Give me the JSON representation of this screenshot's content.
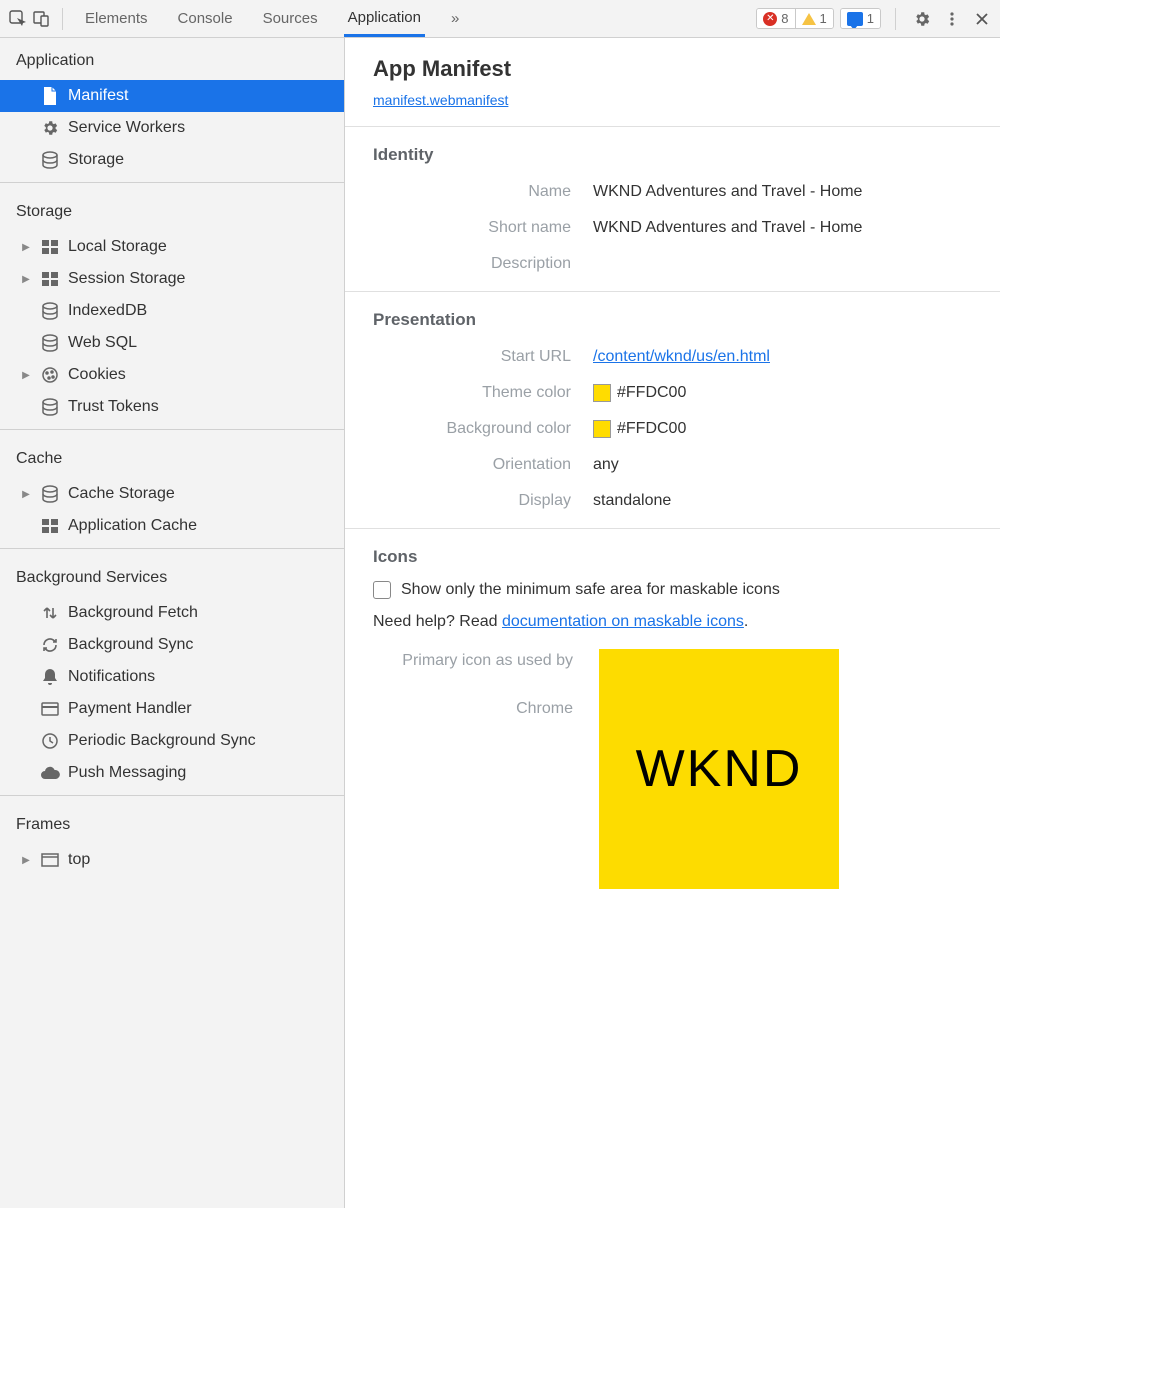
{
  "toolbar": {
    "tabs": [
      "Elements",
      "Console",
      "Sources",
      "Application"
    ],
    "active_tab": "Application",
    "more_glyph": "»",
    "errors_count": "8",
    "warnings_count": "1",
    "messages_count": "1"
  },
  "sidebar": {
    "groups": [
      {
        "title": "Application",
        "items": [
          {
            "label": "Manifest",
            "icon": "file-icon",
            "selected": true
          },
          {
            "label": "Service Workers",
            "icon": "gear-icon"
          },
          {
            "label": "Storage",
            "icon": "database-icon"
          }
        ]
      },
      {
        "title": "Storage",
        "items": [
          {
            "label": "Local Storage",
            "icon": "grid-icon",
            "expandable": true
          },
          {
            "label": "Session Storage",
            "icon": "grid-icon",
            "expandable": true
          },
          {
            "label": "IndexedDB",
            "icon": "database-icon"
          },
          {
            "label": "Web SQL",
            "icon": "database-icon"
          },
          {
            "label": "Cookies",
            "icon": "cookie-icon",
            "expandable": true
          },
          {
            "label": "Trust Tokens",
            "icon": "database-icon"
          }
        ]
      },
      {
        "title": "Cache",
        "items": [
          {
            "label": "Cache Storage",
            "icon": "database-icon",
            "expandable": true
          },
          {
            "label": "Application Cache",
            "icon": "grid-icon"
          }
        ]
      },
      {
        "title": "Background Services",
        "items": [
          {
            "label": "Background Fetch",
            "icon": "updown-icon"
          },
          {
            "label": "Background Sync",
            "icon": "sync-icon"
          },
          {
            "label": "Notifications",
            "icon": "bell-icon"
          },
          {
            "label": "Payment Handler",
            "icon": "card-icon"
          },
          {
            "label": "Periodic Background Sync",
            "icon": "clock-icon"
          },
          {
            "label": "Push Messaging",
            "icon": "cloud-icon"
          }
        ]
      },
      {
        "title": "Frames",
        "items": [
          {
            "label": "top",
            "icon": "frame-icon",
            "expandable": true
          }
        ]
      }
    ]
  },
  "manifest": {
    "heading": "App Manifest",
    "file_link": "manifest.webmanifest",
    "identity_heading": "Identity",
    "identity": {
      "name_label": "Name",
      "name_value": "WKND Adventures and Travel - Home",
      "short_name_label": "Short name",
      "short_name_value": "WKND Adventures and Travel - Home",
      "description_label": "Description",
      "description_value": ""
    },
    "presentation_heading": "Presentation",
    "presentation": {
      "start_url_label": "Start URL",
      "start_url_value": "/content/wknd/us/en.html",
      "theme_color_label": "Theme color",
      "theme_color_value": "#FFDC00",
      "background_color_label": "Background color",
      "background_color_value": "#FFDC00",
      "orientation_label": "Orientation",
      "orientation_value": "any",
      "display_label": "Display",
      "display_value": "standalone"
    },
    "icons_heading": "Icons",
    "icons": {
      "maskable_checkbox_label": "Show only the minimum safe area for maskable icons",
      "help_prefix": "Need help? Read ",
      "help_link": "documentation on maskable icons",
      "help_suffix": ".",
      "primary_label_l1": "Primary icon as used by",
      "primary_label_l2": "Chrome",
      "wknd_text": "WKND"
    }
  }
}
